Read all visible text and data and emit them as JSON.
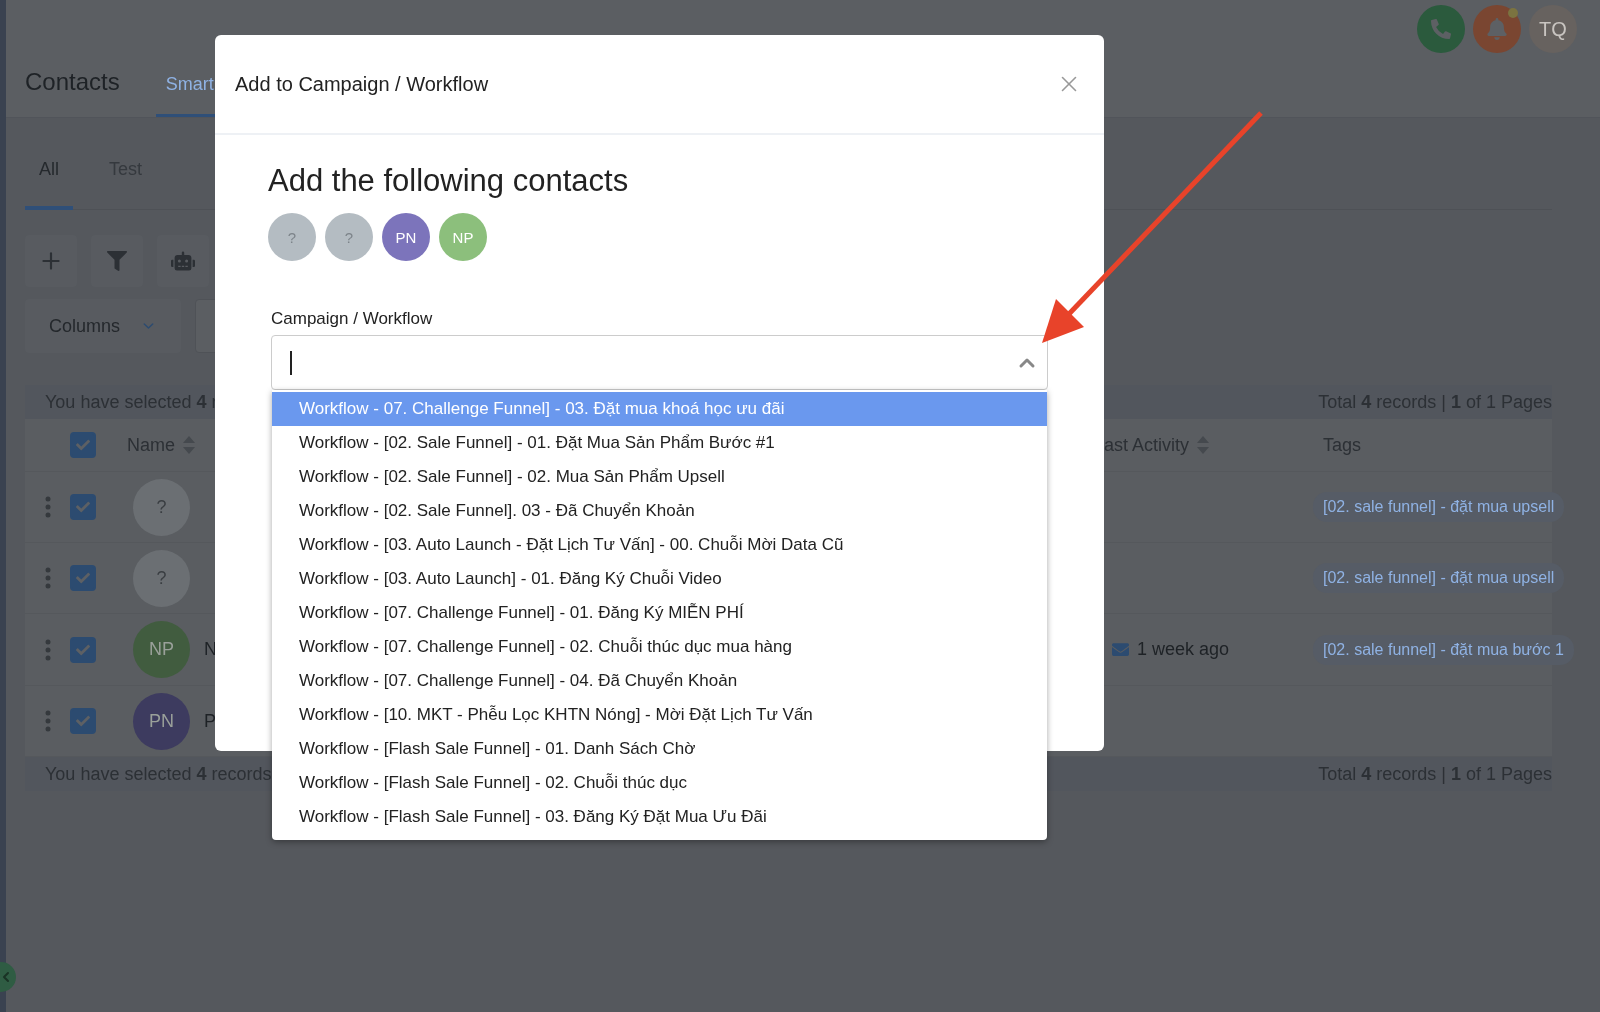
{
  "header": {
    "title": "Contacts",
    "tabs": [
      {
        "label": "Smart",
        "selected": true
      }
    ],
    "notification": true,
    "user_initials": "TQ"
  },
  "subtabs": [
    {
      "label": "All",
      "selected": true
    },
    {
      "label": "Test",
      "selected": false
    }
  ],
  "columns_button": {
    "label": "Columns"
  },
  "selection_top": "You have selected **4** r",
  "pagination_top": "Total **4** records | **1** of 1 Pages",
  "table": {
    "select_all": {
      "checked": true
    },
    "columns": [
      {
        "label": "Name",
        "sortable": true
      },
      {
        "label": "ast Activity",
        "sortable": true
      },
      {
        "label": "Tags"
      }
    ],
    "rows": [
      {
        "checked": true,
        "initials": "?",
        "color": "#6b6f73",
        "tag": "[02. sale funnel] - đặt mua upsell"
      },
      {
        "checked": true,
        "initials": "?",
        "color": "#6b6f73",
        "tag": "[02. sale funnel] - đặt mua upsell"
      },
      {
        "checked": true,
        "initials": "NP",
        "color": "#415c3f",
        "name": "N",
        "last_activity": "1 week ago",
        "tag": "[02. sale funnel] - đặt mua bước 1"
      },
      {
        "checked": true,
        "initials": "PN",
        "color": "#3d3b5f",
        "name": "P"
      }
    ]
  },
  "selection_bottom": "You have selected **4** records",
  "pagination_bottom": "Total **4** records | **1** of 1 Pages",
  "modal": {
    "title": "Add to Campaign / Workflow",
    "heading": "Add the following contacts",
    "contacts": [
      {
        "initials": "?",
        "color": "#b4bcc2"
      },
      {
        "initials": "?",
        "color": "#b4bcc2"
      },
      {
        "initials": "PN",
        "color": "#7c74bb"
      },
      {
        "initials": "NP",
        "color": "#8cbf7c"
      }
    ],
    "field": {
      "label": "Campaign / Workflow",
      "expanded": true,
      "options": [
        {
          "label": "Workflow - 07. Challenge Funnel] - 03. Đặt mua khoá học ưu đãi",
          "selected": true
        },
        {
          "label": "Workflow - [02. Sale Funnel] - 01. Đặt Mua Sản Phẩm Bước #1",
          "selected": false
        },
        {
          "label": "Workflow - [02. Sale Funnel] - 02. Mua Sản Phẩm Upsell",
          "selected": false
        },
        {
          "label": "Workflow - [02. Sale Funnel]. 03 - Đã Chuyển Khoản",
          "selected": false
        },
        {
          "label": "Workflow - [03. Auto Launch - Đặt Lịch Tư Vấn] - 00. Chuỗi Mời Data Cũ",
          "selected": false
        },
        {
          "label": "Workflow - [03. Auto Launch] - 01. Đăng Ký Chuỗi Video",
          "selected": false
        },
        {
          "label": "Workflow - [07. Challenge Funnel] - 01. Đăng Ký MIỄN PHÍ",
          "selected": false
        },
        {
          "label": "Workflow - [07. Challenge Funnel] - 02. Chuỗi thúc dục mua hàng",
          "selected": false
        },
        {
          "label": "Workflow - [07. Challenge Funnel] - 04. Đã Chuyển Khoản",
          "selected": false
        },
        {
          "label": "Workflow - [10. MKT - Phễu Lọc KHTN Nóng] - Mời Đặt Lịch Tư Vấn",
          "selected": false
        },
        {
          "label": "Workflow - [Flash Sale Funnel] - 01. Danh Sách Chờ",
          "selected": false
        },
        {
          "label": "Workflow - [Flash Sale Funnel] - 02. Chuỗi thúc dục",
          "selected": false
        },
        {
          "label": "Workflow - [Flash Sale Funnel] - 03. Đăng Ký Đặt Mua Ưu Đãi",
          "selected": false
        }
      ]
    }
  }
}
